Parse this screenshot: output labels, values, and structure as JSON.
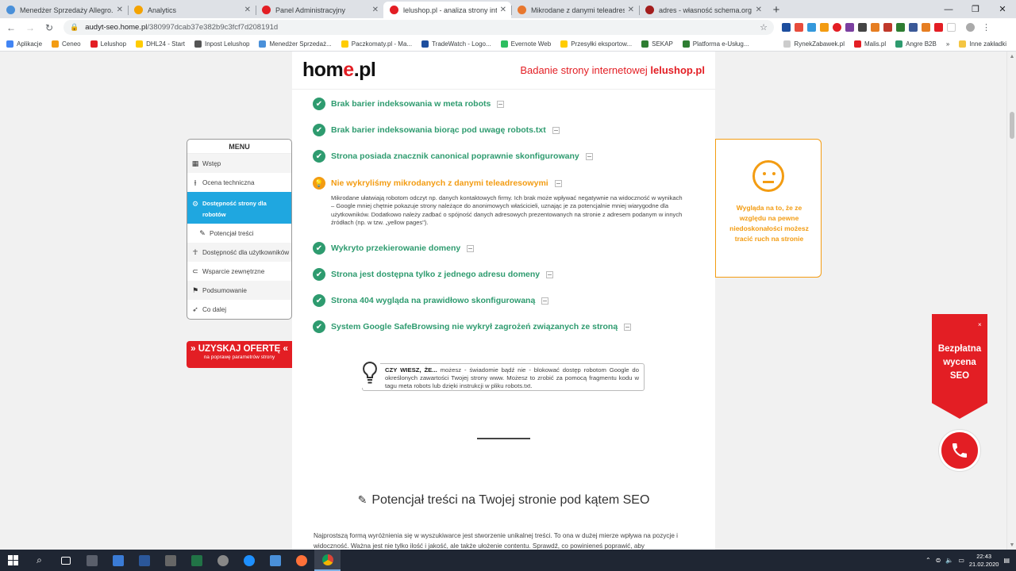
{
  "browser": {
    "tabs": [
      {
        "title": "Menedżer Sprzedaży Allegro.pl",
        "icon": "allegro-icon",
        "color": "#4a90d9",
        "active": false
      },
      {
        "title": "Analytics",
        "icon": "analytics-icon",
        "color": "#f4a300",
        "active": false
      },
      {
        "title": "Panel Administracyjny",
        "icon": "lelushop-icon",
        "color": "#e31e24",
        "active": false
      },
      {
        "title": "lelushop.pl - analiza strony intern",
        "icon": "home-pl-icon",
        "color": "#e31e24",
        "active": true
      },
      {
        "title": "Mikrodane z danymi teleadreso",
        "icon": "web-icon",
        "color": "#e8772e",
        "active": false
      },
      {
        "title": "adres - własność schema.org",
        "icon": "schema-icon",
        "color": "#a31d1d",
        "active": false
      }
    ],
    "url_host": "audyt-seo.home.pl",
    "url_path": "/380997dcab37e382b9c3fcf7d208191d",
    "bookmarks": [
      {
        "label": "Aplikacje",
        "color": "#4285f4"
      },
      {
        "label": "Ceneo",
        "color": "#f39c12"
      },
      {
        "label": "Lelushop",
        "color": "#e31e24"
      },
      {
        "label": "DHL24 - Start",
        "color": "#ffcc00"
      },
      {
        "label": "Inpost Lelushop",
        "color": "#555555"
      },
      {
        "label": "Menedżer Sprzedaż...",
        "color": "#4a90d9"
      },
      {
        "label": "Paczkomaty.pl - Ma...",
        "color": "#ffcc00"
      },
      {
        "label": "TradeWatch - Logo...",
        "color": "#1d4e9e"
      },
      {
        "label": "Evernote Web",
        "color": "#2dbe60"
      },
      {
        "label": "Przesyłki eksportow...",
        "color": "#ffcc00"
      },
      {
        "label": "SEKAP",
        "color": "#2e7d32"
      },
      {
        "label": "Platforma e-Usług...",
        "color": "#2e7d32"
      }
    ],
    "bookmarks_right": [
      {
        "label": "RynekZabawek.pl",
        "color": "#cccccc"
      },
      {
        "label": "Malis.pl",
        "color": "#e31e24"
      },
      {
        "label": "Angre B2B",
        "color": "#2e9b6f"
      }
    ],
    "more_bookmarks": "»",
    "other_bookmarks": "Inne zakładki"
  },
  "header": {
    "logo_pre": "hom",
    "logo_e": "e",
    "logo_post": ".pl",
    "study_prefix": "Badanie strony internetowej",
    "study_site": "lelushop.pl"
  },
  "checks": [
    {
      "label": "Brak barier indeksowania w meta robots",
      "status": "ok"
    },
    {
      "label": "Brak barier indeksowania biorąc pod uwagę robots.txt",
      "status": "ok"
    },
    {
      "label": "Strona posiada znacznik canonical poprawnie skonfigurowany",
      "status": "ok"
    },
    {
      "label": "Nie wykryliśmy mikrodanych z danymi teleadresowymi",
      "status": "warn"
    },
    {
      "label": "Wykryto przekierowanie domeny",
      "status": "ok"
    },
    {
      "label": "Strona jest dostępna tylko z jednego adresu domeny",
      "status": "ok"
    },
    {
      "label": "Strona 404 wygląda na prawidłowo skonfigurowaną",
      "status": "ok"
    },
    {
      "label": "System Google SafeBrowsing nie wykrył zagrożeń związanych ze stroną",
      "status": "ok"
    }
  ],
  "warn_description": "Mikrodane ułatwiają robotom odczyt np. danych kontaktowych firmy. Ich brak może wpływać negatywnie na widoczność w wynikach – Google mniej chętnie pokazuje strony należące do anonimowych właścicieli, uznając je za potencjalnie mniej wiarygodne dla użytkowników. Dodatkowo należy zadbać o spójność danych adresowych prezentowanych na stronie z adresem podanym w innych źródłach (np. w tzw. „yellow pages\").",
  "tip": {
    "lead": "CZY WIESZ, ŻE...",
    "text": " możesz - świadomie bądź nie - blokować dostęp robotom Google do określonych zawartości Twojej strony www. Możesz to zrobić za pomocą fragmentu kodu w tagu meta robots lub dzięki instrukcji w pliku robots.txt."
  },
  "section": {
    "title": "Potencjał treści na Twojej stronie pod kątem SEO",
    "body": "Najprostszą formą wyróżnienia się w wyszukiwarce jest stworzenie unikalnej treści. To ona w dużej mierze wpływa na pozycje i widoczność. Ważna jest nie tylko ilość i jakość, ale także ułożenie contentu. Sprawdź, co powinieneś poprawić, aby"
  },
  "menu": {
    "title": "MENU",
    "items": [
      {
        "label": "Wstęp",
        "icon": "grid-icon"
      },
      {
        "label": "Ocena techniczna",
        "icon": "sliders-icon"
      },
      {
        "label": "Dostępność strony dla robotów",
        "icon": "gears-icon",
        "active": true
      },
      {
        "label": "Potencjał treści",
        "icon": "pencil-icon",
        "sub": true
      },
      {
        "label": "Dostępność dla użytkowników",
        "icon": "person-icon"
      },
      {
        "label": "Wsparcie zewnętrzne",
        "icon": "magnet-icon"
      },
      {
        "label": "Podsumowanie",
        "icon": "flag-icon"
      },
      {
        "label": "Co dalej",
        "icon": "rocket-icon"
      }
    ]
  },
  "offer": {
    "label": "» UZYSKAJ OFERTĘ «",
    "sub": "na poprawę parametrów strony"
  },
  "card": {
    "text": "Wygląda na to, że ze względu na pewne niedoskonałości możesz tracić ruch na stronie"
  },
  "seo_badge": {
    "line1": "Bezpłatna",
    "line2": "wycena",
    "line3": "SEO",
    "close": "×"
  },
  "taskbar": {
    "time": "22:43",
    "date": "21.02.2020"
  },
  "colors": {
    "ok": "#2e9b6f",
    "warn": "#f39c12",
    "brand": "#e31e24",
    "menu_active": "#1fa7e0"
  }
}
